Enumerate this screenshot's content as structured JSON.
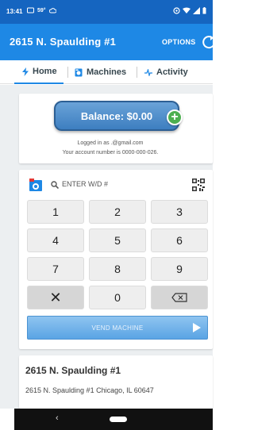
{
  "status_bar": {
    "time": "13:41",
    "temp": "59°"
  },
  "header": {
    "title": "2615 N. Spaulding #1",
    "options_label": "OPTIONS"
  },
  "tabs": [
    {
      "label": "Home",
      "icon": "bolt-icon",
      "active": true
    },
    {
      "label": "Machines",
      "icon": "machine-icon",
      "active": false
    },
    {
      "label": "Activity",
      "icon": "pulse-icon",
      "active": false
    }
  ],
  "balance": {
    "button_label": "Balance: $0.00",
    "logged_in_text": "Logged in as                    .@gmail.com",
    "account_text": "Your account number is 0000-000-026."
  },
  "keypad": {
    "search_placeholder": "ENTER W/D #",
    "keys": [
      "1",
      "2",
      "3",
      "4",
      "5",
      "6",
      "7",
      "8",
      "9",
      "✕",
      "0",
      "⌫"
    ],
    "vend_label": "VEND MACHINE"
  },
  "location": {
    "title": "2615 N. Spaulding #1",
    "address": "2615 N. Spaulding #1 Chicago, IL 60647"
  },
  "colors": {
    "status_bar": "#1565c0",
    "app_bar": "#1e88e5",
    "add_button": "#4caf50"
  }
}
